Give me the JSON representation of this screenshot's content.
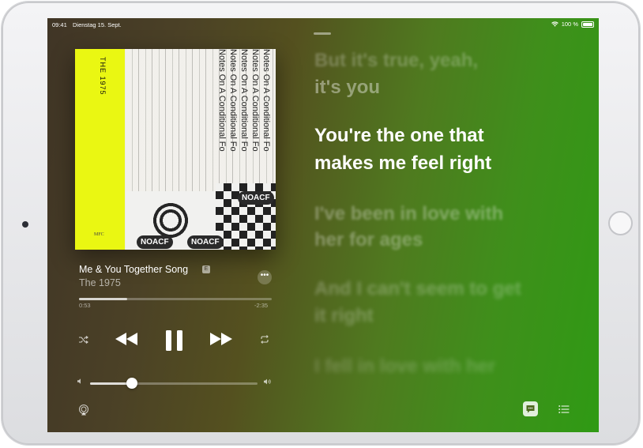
{
  "status": {
    "time": "09:41",
    "date": "Dienstag 15. Sept.",
    "battery": "100 %"
  },
  "album": {
    "band": "THE 1975",
    "imprint": "MFC",
    "cover_text": "Notes On A Conditional Fo",
    "badge": "NOACF"
  },
  "player": {
    "song_title": "Me & You Together Song",
    "explicit": "E",
    "artist": "The 1975",
    "elapsed": "0:53",
    "remaining": "-2:35",
    "progress_fraction": 0.25,
    "volume_fraction": 0.25,
    "more": "•••"
  },
  "lyrics": {
    "previous": [
      "But it's true, yeah,",
      "it's you"
    ],
    "current": [
      "You're the one that",
      "makes me feel right"
    ],
    "upcoming": [
      "I've been in love with",
      "her for ages",
      "And I can't seem to get",
      "it right",
      "I fell in love with her"
    ]
  },
  "icons": [
    "wifi-icon",
    "battery-icon",
    "shuffle-icon",
    "previous-icon",
    "pause-icon",
    "next-icon",
    "repeat-icon",
    "volume-low-icon",
    "volume-high-icon",
    "airplay-icon",
    "lyrics-icon",
    "queue-icon"
  ]
}
